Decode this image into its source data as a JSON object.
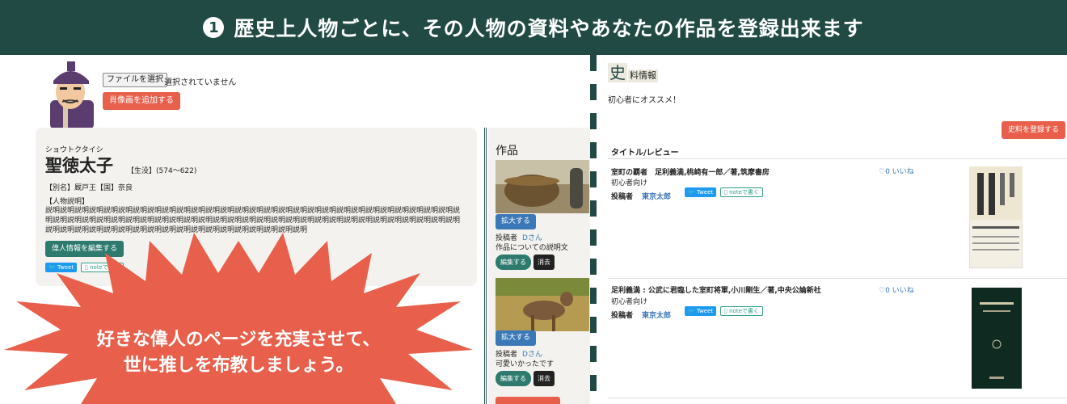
{
  "banner": {
    "number": "1",
    "text": "歴史上人物ごとに、その人物の資料やあなたの作品を登録出来ます"
  },
  "profile": {
    "file_button": "ファイルを選択",
    "file_status": "選択されていません",
    "add_portrait": "肖像画を追加する",
    "kana": "ショウトクタイシ",
    "name": "聖徳太子",
    "lifespan": "【生没】(574〜622)",
    "alias": "【別名】厩戸王【国】奈良",
    "desc_label": "【人物説明】",
    "desc": "説明説明説明説明説明説明説明説明説明説明説明説明説明説明説明説明説明説明説明説明説明説明説明説明説明説明説明説明説明説明説明説明説明説明説明説明説明説明説明説明説明説明説明説明説明説明説明説明説明説明説明説明説明説明説明説明説明説明説明説明説明説明説明説明説明説明説明説明説明説明説明説明説明説明説明",
    "edit_button": "偉人情報を編集する",
    "tweet": "Tweet",
    "note": "noteで書く"
  },
  "works": {
    "title": "作品",
    "items": [
      {
        "enlarge": "拡大する",
        "poster_label": "投稿者",
        "poster": "Dさん",
        "desc": "作品についての説明文",
        "edit": "編集する",
        "delete": "消去"
      },
      {
        "enlarge": "拡大する",
        "poster_label": "投稿者",
        "poster": "Dさん",
        "desc": "可愛いかったです",
        "edit": "編集する",
        "delete": "消去"
      }
    ]
  },
  "callout": {
    "line1": "好きな偉人のページを充実させて、",
    "line2": "世に推しを布教しましょう。"
  },
  "materials": {
    "heading_big": "史",
    "heading_rest": "料情報",
    "subtitle": "初心者にオススメ！",
    "add_button": "史料を登録する",
    "column": "タイトル/レビュー",
    "rows": [
      {
        "title": "室町の覇者　足利義満,桃崎有一郎／著,筑摩書房",
        "level": "初心者向け",
        "poster_label": "投稿者",
        "poster": "東京太郎",
        "tweet": "Tweet",
        "note": "noteで書く",
        "likes": "0 いいね"
      },
      {
        "title": "足利義満 : 公武に君臨した室町将軍,小川剛生／著,中央公論新社",
        "level": "初心者向け",
        "poster_label": "投稿者",
        "poster": "東京太郎",
        "tweet": "Tweet",
        "note": "noteで書く",
        "likes": "0 いいね"
      }
    ]
  },
  "colors": {
    "banner": "#214a44",
    "accent_red": "#e8604c",
    "teal": "#2e7a6e",
    "blue": "#3b78b7"
  }
}
